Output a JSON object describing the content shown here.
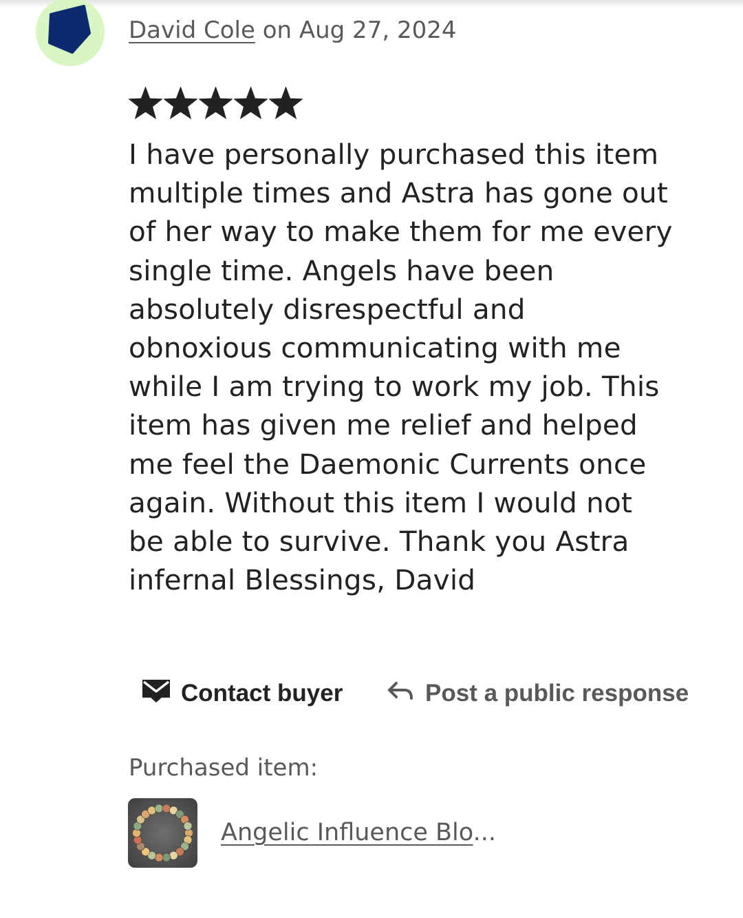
{
  "review": {
    "author": "David Cole",
    "date_text": "on Aug 27, 2024",
    "rating": 5,
    "rating_max": 5,
    "lines": [
      "I have personally purchased this item",
      "multiple times and Astra has gone out",
      "of her way to make them for me every",
      "single time. Angels have been",
      "absolutely disrespectful and",
      "obnoxious communicating with me",
      "while I am trying to work my job. This",
      "item has given me relief and helped",
      "me feel the Daemonic Currents once",
      "again. Without this item I would not",
      "be able to survive. Thank you Astra",
      "infernal Blessings, David"
    ]
  },
  "avatar": {
    "icon": "user-avatar-pentagon",
    "bg_color": "#d7f6c1",
    "shape_color": "#0b2a6f"
  },
  "actions": {
    "contact_label": "Contact buyer",
    "contact_icon": "envelope-icon",
    "respond_label": "Post a public response",
    "respond_icon": "reply-arrow-icon"
  },
  "purchased": {
    "label": "Purchased item:",
    "item_title": "Angelic Influence Blo",
    "item_title_ellipsis": "...",
    "thumbnail_icon": "bead-bracelet-image"
  },
  "colors": {
    "text_primary": "#222222",
    "text_secondary": "#595959",
    "star": "#222222"
  }
}
